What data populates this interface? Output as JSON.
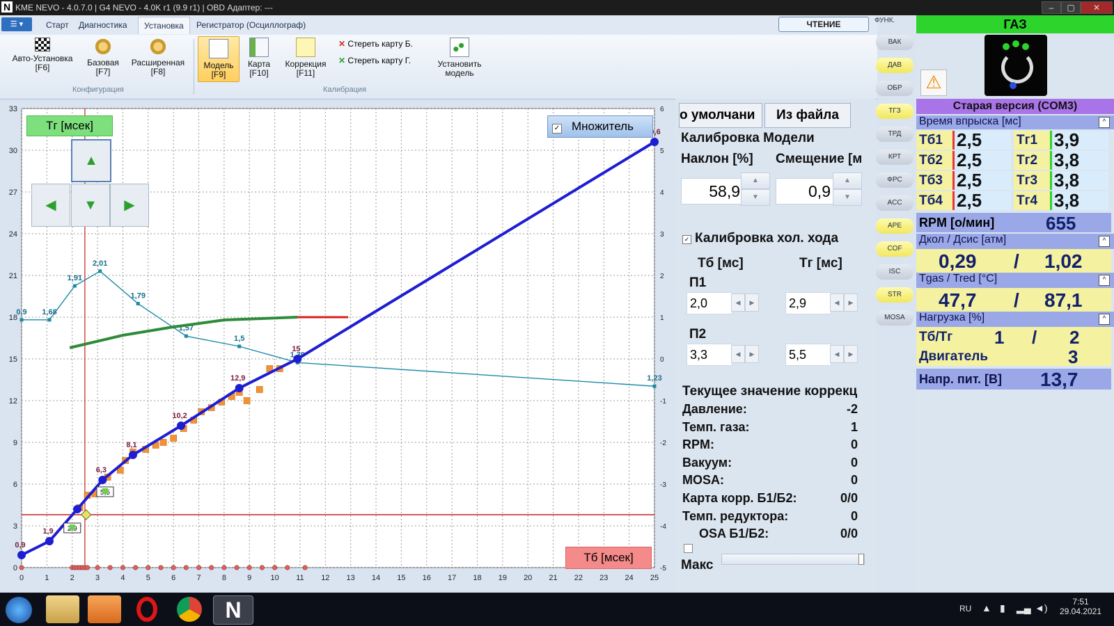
{
  "window": {
    "title": "KME NEVO - 4.0.7.0  |  G4 NEVO - 4.0K r1 (9.9 r1)  |  OBD Адаптер: ---",
    "logo": "N"
  },
  "menu": {
    "tabs": [
      "Старт",
      "Диагностика",
      "Установка",
      "Регистратор (Осциллограф)"
    ],
    "active": "Установка",
    "read_button": "ЧТЕНИЕ",
    "func_label": "ФУНК."
  },
  "ribbon": {
    "config_group": "Конфигурация",
    "calib_group": "Калибрация",
    "buttons": [
      {
        "label": "Авто-Установка",
        "key": "[F6]",
        "icon": "checkered-flag-icon"
      },
      {
        "label": "Базовая",
        "key": "[F7]",
        "icon": "gear-icon"
      },
      {
        "label": "Расширенная",
        "key": "[F8]",
        "icon": "gear-icon"
      },
      {
        "label": "Модель",
        "key": "[F9]",
        "icon": "model-chart-icon"
      },
      {
        "label": "Карта",
        "key": "[F10]",
        "icon": "map-grid-icon"
      },
      {
        "label": "Коррекция",
        "key": "[F11]",
        "icon": "correction-grid-icon"
      }
    ],
    "erase_b": "Стереть карту Б.",
    "erase_g": "Стереть карту Г.",
    "set_model": [
      "Установить",
      "модель"
    ]
  },
  "side_buttons": [
    "ВАК",
    "ДАВ",
    "ОБР",
    "ТГЗ",
    "ТРД",
    "КРТ",
    "ФРС",
    "ACC",
    "APE",
    "COF",
    "ISC",
    "STR",
    "MOSA"
  ],
  "chart": {
    "y_title_label": "Тг [мсек]",
    "x_title_label": "Тб [мсек]",
    "multiplier_label": "Множитель",
    "multiplier_checked": true
  },
  "chart_data": {
    "type": "line",
    "x_ticks": [
      0,
      1,
      2,
      3,
      4,
      5,
      6,
      7,
      8,
      9,
      10,
      11,
      12,
      13,
      14,
      15,
      16,
      17,
      18,
      19,
      20,
      21,
      22,
      23,
      24,
      25
    ],
    "y_ticks": [
      0,
      3,
      6,
      9,
      12,
      15,
      18,
      21,
      24,
      27,
      30,
      33
    ],
    "y2_ticks": [
      -5,
      -4,
      -3,
      -2,
      -1,
      0,
      1,
      2,
      3,
      4,
      5,
      6
    ],
    "xlim": [
      0,
      25
    ],
    "ylim": [
      0,
      33
    ],
    "y2lim": [
      -5,
      6
    ],
    "model_line": {
      "x": [
        0,
        1.1,
        2.2,
        3.2,
        4.4,
        6.3,
        8.6,
        10.9,
        25
      ],
      "y": [
        0.9,
        1.9,
        4.2,
        6.3,
        8.1,
        10.2,
        12.9,
        15,
        30.6
      ]
    },
    "model_labels": [
      "0,9",
      "1,9",
      "6,3",
      "8,1",
      "10,2",
      "12,9",
      "15",
      "30,6"
    ],
    "multiplier_line": {
      "x": [
        0,
        1.1,
        2.1,
        3.1,
        4.6,
        6.5,
        8.6,
        10.9,
        25
      ],
      "y": [
        1.68,
        1.68,
        1.91,
        2.01,
        1.79,
        1.57,
        1.5,
        1.39,
        1.23
      ]
    },
    "multiplier_labels": [
      "0,9",
      "1,68",
      "1,91",
      "2,01",
      "1,79",
      "1,57",
      "1,5",
      "1,39",
      "1,23"
    ],
    "green_curve": {
      "x": [
        1.9,
        4,
        6,
        8,
        10.9
      ],
      "y": [
        15.8,
        16.7,
        17.3,
        17.8,
        18
      ]
    },
    "red_curve": {
      "x": [
        10.9,
        12.9
      ],
      "y": [
        18,
        18
      ]
    },
    "samples": {
      "x": [
        2.3,
        2.6,
        2.9,
        3.2,
        3.4,
        3.9,
        4.1,
        4.4,
        4.9,
        5.3,
        5.6,
        6.0,
        6.4,
        6.8,
        7.1,
        7.5,
        7.9,
        8.3,
        8.6,
        8.9,
        9.4,
        9.8,
        10.2
      ],
      "y": [
        4.3,
        5.2,
        5.3,
        5.5,
        6.5,
        7.0,
        7.7,
        8.3,
        8.5,
        8.8,
        9.0,
        9.3,
        10.0,
        10.6,
        11.2,
        11.5,
        11.9,
        12.3,
        12.6,
        12.0,
        12.8,
        14.3,
        14.3
      ]
    },
    "cursor_x": 2.5,
    "hline_y": 3.8,
    "markers": [
      {
        "x": 2.0,
        "label": "2,9"
      },
      {
        "x": 3.3,
        "label": "5,5"
      }
    ],
    "bottom_dots_x": [
      0,
      2.0,
      2.1,
      2.2,
      2.3,
      2.4,
      2.5,
      2.6,
      3.0,
      3.5,
      4.0,
      4.5,
      5.0,
      5.5,
      6.0,
      6.5,
      7.0,
      7.5,
      8.0,
      8.5,
      9.0,
      9.5,
      10.0,
      10.5,
      11.2
    ]
  },
  "model": {
    "default_btn": "о умолчани",
    "file_btn": "Из файла",
    "section": "Калибровка Модели",
    "slope_label": "Наклон [%]",
    "offset_label": "Смещение [м",
    "slope": "58,9",
    "offset": "0,9",
    "idle_check": "Калибровка хол. хода",
    "idle_checked": true,
    "tb_label": "Тб [мс]",
    "tg_label": "Тг [мс]",
    "p1": "П1",
    "p2": "П2",
    "p1_tb": "2,0",
    "p1_tg": "2,9",
    "p2_tb": "3,3",
    "p2_tg": "5,5"
  },
  "corrections": {
    "title": "Текущее значение коррекц",
    "rows": [
      {
        "label": "Давление:",
        "value": "-2"
      },
      {
        "label": "Темп. газа:",
        "value": "1"
      },
      {
        "label": "RPM:",
        "value": "0"
      },
      {
        "label": "Вакуум:",
        "value": "0"
      },
      {
        "label": "MOSA:",
        "value": "0"
      },
      {
        "label": "Карта корр. Б1/Б2:",
        "value": "0/0"
      },
      {
        "label": "Темп. редуктора:",
        "value": "0"
      },
      {
        "label": "OSA Б1/Б2:",
        "value": "0/0"
      }
    ],
    "max_label": "Макс"
  },
  "status": {
    "fuel": "ГАЗ",
    "version": "Старая версия (COM3)",
    "injection_header": "Время впрыска [мс]",
    "petrol": [
      {
        "label": "Тб1",
        "value": "2,5"
      },
      {
        "label": "Тб2",
        "value": "2,5"
      },
      {
        "label": "Тб3",
        "value": "2,5"
      },
      {
        "label": "Тб4",
        "value": "2,5"
      }
    ],
    "gas": [
      {
        "label": "Тг1",
        "value": "3,9"
      },
      {
        "label": "Тг2",
        "value": "3,8"
      },
      {
        "label": "Тг3",
        "value": "3,8"
      },
      {
        "label": "Тг4",
        "value": "3,8"
      }
    ],
    "rpm_label": "RPM [о/мин]",
    "rpm": "655",
    "pressure_header": "Дкол / Дсис [атм]",
    "pressure_a": "0,29",
    "pressure_b": "1,02",
    "temp_header": "Tgas / Tred [°C]",
    "temp_a": "47,7",
    "temp_b": "87,1",
    "load_header": "Нагрузка [%]",
    "load_label": "Тб/Тг",
    "load_a": "1",
    "load_b": "2",
    "engine_label": "Двигатель",
    "engine": "3",
    "voltage_label": "Напр. пит. [В]",
    "voltage": "13,7",
    "slash": "/",
    "colors": {
      "gas_green": "#2cd42c",
      "header_blue": "#9aa8e8",
      "value_yellow": "#f4f1a0",
      "warning": "#f08a00"
    }
  },
  "taskbar": {
    "lang": "RU",
    "time": "7:51",
    "date": "29.04.2021"
  }
}
